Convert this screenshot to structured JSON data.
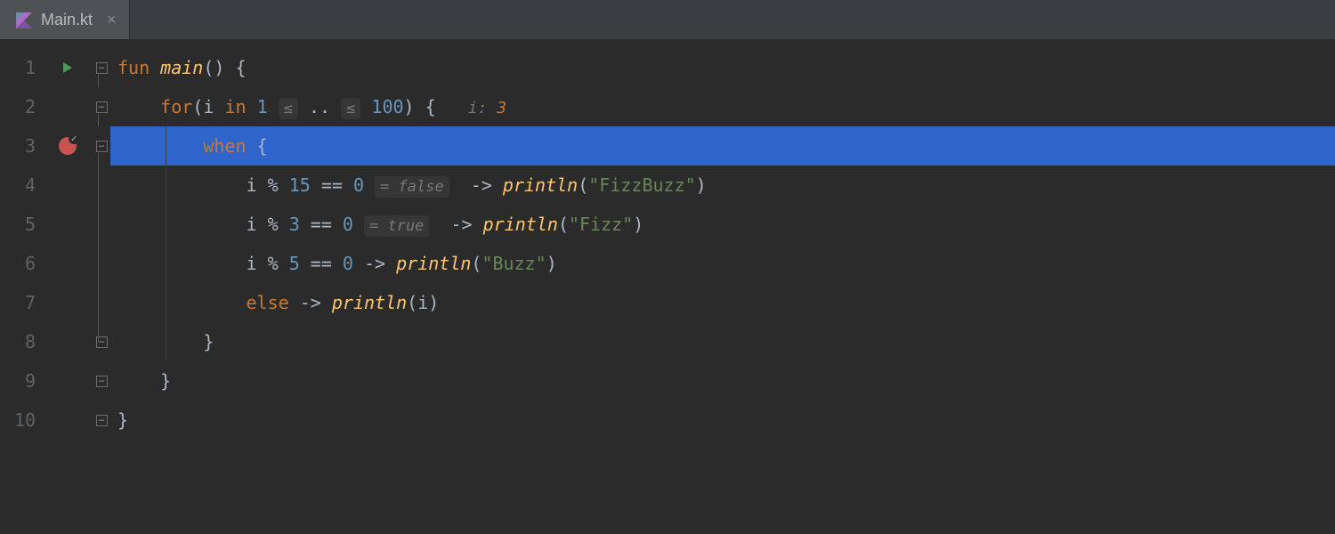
{
  "tab": {
    "filename": "Main.kt",
    "close": "×"
  },
  "lines": {
    "n1": "1",
    "n2": "2",
    "n3": "3",
    "n4": "4",
    "n5": "5",
    "n6": "6",
    "n7": "7",
    "n8": "8",
    "n9": "9",
    "n10": "10"
  },
  "code": {
    "l1": {
      "fun": "fun",
      "main": "main",
      "paren": "()",
      "brace": " {"
    },
    "l2": {
      "for": "for",
      "open": "(",
      "i": "i",
      "in": "in",
      "one": "1",
      "le1": "≤",
      "range": "..",
      "le2": "≤",
      "hundred": "100",
      "close": ") {",
      "inlay_i": "i: ",
      "inlay_val": "3"
    },
    "l3": {
      "when": "when",
      "brace": " {"
    },
    "l4": {
      "i": "i",
      "mod": " % ",
      "n": "15",
      "eq": " == ",
      "zero": "0",
      "inlay": "= false",
      "arrow": " -> ",
      "println": "println",
      "open": "(",
      "str": "\"FizzBuzz\"",
      "close": ")"
    },
    "l5": {
      "i": "i",
      "mod": " % ",
      "n": "3",
      "eq": " == ",
      "zero": "0",
      "inlay": "= true",
      "arrow": " -> ",
      "println": "println",
      "open": "(",
      "str": "\"Fizz\"",
      "close": ")"
    },
    "l6": {
      "i": "i",
      "mod": " % ",
      "n": "5",
      "eq": " == ",
      "zero": "0",
      "arrow": " -> ",
      "println": "println",
      "open": "(",
      "str": "\"Buzz\"",
      "close": ")"
    },
    "l7": {
      "else": "else",
      "arrow": " -> ",
      "println": "println",
      "open": "(",
      "i": "i",
      "close": ")"
    },
    "l8": {
      "brace": "}"
    },
    "l9": {
      "brace": "}"
    },
    "l10": {
      "brace": "}"
    }
  },
  "indent": "    "
}
